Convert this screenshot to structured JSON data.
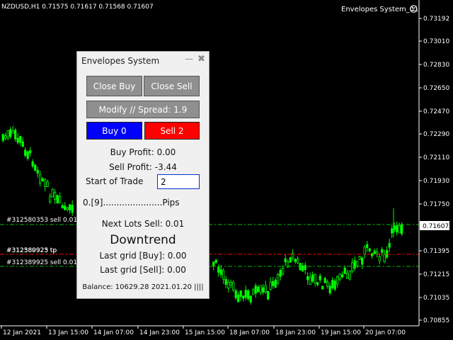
{
  "chart_header": {
    "symbol_info": "NZDUSD,H1  0.71575 0.71617 0.71568 0.71607",
    "ea_name": "Envelopes System_01",
    "smiley": "☺"
  },
  "price_axis": {
    "labels": [
      "0.73192",
      "0.73010",
      "0.72830",
      "0.72650",
      "0.72470",
      "0.72290",
      "0.72110",
      "0.71930",
      "0.71750",
      "0.71607",
      "0.71395",
      "0.71215",
      "0.71035",
      "0.70855"
    ]
  },
  "date_axis": {
    "labels": [
      "12 Jan 2021",
      "13 Jan 15:00",
      "14 Jan 07:00",
      "14 Jan 23:00",
      "15 Jan 15:00",
      "18 Jan 07:00",
      "18 Jan 23:00",
      "19 Jan 15:00",
      "20 Jan 07:00"
    ]
  },
  "chart_overlays": {
    "order_sell_1": "#312580353 sell 0.01",
    "order_tp": "#312580923 tp",
    "order_tp_overlap": "#312389925 tp",
    "order_sell_2": "#312389925 sell 0.01",
    "current_price_tag": "0.71607"
  },
  "panel": {
    "title": "Envelopes System",
    "minimize": "—",
    "close": "✖",
    "close_buy": "Close Buy",
    "close_sell": "Close Sell",
    "modify_spread": "Modify // Spread: 1.9",
    "buy_btn": "Buy 0",
    "sell_btn": "Sell 2",
    "buy_profit": "Buy Profit: 0.00",
    "sell_profit": "Sell Profit: -3.44",
    "start_label": "Start of Trade",
    "start_value": "2",
    "pips_line": "0.[9]......................Pips",
    "next_lots": "Next Lots Sell: 0.01",
    "trend": "Downtrend",
    "last_grid_buy": "Last grid [Buy]: 0.00",
    "last_grid_sell": "Last grid [Sell]: 0.00",
    "balance": "Balance: 10629.28 2021.01.20 ||||"
  },
  "colors": {
    "background": "#000000",
    "bull_candle": "#00ff00",
    "bear_candle": "#00ff00",
    "sell_line": "#00c000",
    "tp_line": "#ff0000",
    "buy_button": "#0000ff",
    "sell_button": "#ff0000"
  }
}
